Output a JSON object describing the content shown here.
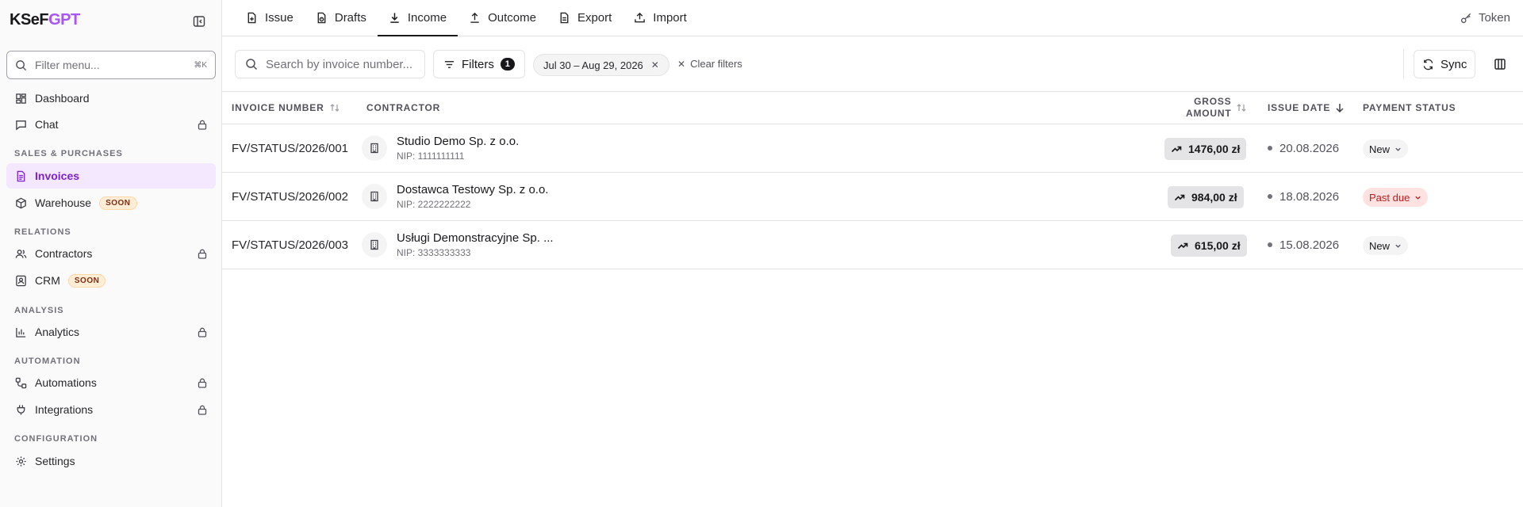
{
  "app": {
    "logo_prefix": "KSeF",
    "logo_suffix": "GPT"
  },
  "sidebar": {
    "filter_placeholder": "Filter menu...",
    "filter_shortcut": "⌘K",
    "items": [
      {
        "label": "Dashboard"
      },
      {
        "label": "Chat"
      },
      {
        "label": "Invoices"
      },
      {
        "label": "Warehouse",
        "badge": "SOON"
      },
      {
        "label": "Contractors"
      },
      {
        "label": "CRM",
        "badge": "SOON"
      },
      {
        "label": "Analytics"
      },
      {
        "label": "Automations"
      },
      {
        "label": "Integrations"
      },
      {
        "label": "Settings"
      }
    ],
    "sections": [
      "SALES & PURCHASES",
      "RELATIONS",
      "ANALYSIS",
      "AUTOMATION",
      "CONFIGURATION"
    ]
  },
  "tabs": [
    {
      "label": "Issue"
    },
    {
      "label": "Drafts"
    },
    {
      "label": "Income"
    },
    {
      "label": "Outcome"
    },
    {
      "label": "Export"
    },
    {
      "label": "Import"
    }
  ],
  "token_label": "Token",
  "toolbar": {
    "search_placeholder": "Search by invoice number...",
    "filters_label": "Filters",
    "filters_count": "1",
    "date_chip": "Jul 30 – Aug 29, 2026",
    "clear_filters": "Clear filters",
    "sync_label": "Sync"
  },
  "table": {
    "headers": {
      "invoice_number": "INVOICE NUMBER",
      "contractor": "CONTRACTOR",
      "gross_line1": "GROSS",
      "gross_line2": "AMOUNT",
      "issue_date": "ISSUE DATE",
      "payment_status": "PAYMENT STATUS"
    },
    "rows": [
      {
        "invoice": "FV/STATUS/2026/001",
        "contractor": "Studio Demo Sp. z o.o.",
        "nip": "NIP: 1111111111",
        "amount": "1476,00 zł",
        "date": "20.08.2026",
        "status": "New"
      },
      {
        "invoice": "FV/STATUS/2026/002",
        "contractor": "Dostawca Testowy Sp. z o.o.",
        "nip": "NIP: 2222222222",
        "amount": "984,00 zł",
        "date": "18.08.2026",
        "status": "Past due"
      },
      {
        "invoice": "FV/STATUS/2026/003",
        "contractor": "Usługi Demonstracyjne Sp. ...",
        "nip": "NIP: 3333333333",
        "amount": "615,00 zł",
        "date": "15.08.2026",
        "status": "New"
      }
    ]
  },
  "colors": {
    "accent": "#a855f7",
    "active_bg": "#f3e8ff",
    "past_due_bg": "#fee2e2",
    "past_due_text": "#b91c1c"
  }
}
